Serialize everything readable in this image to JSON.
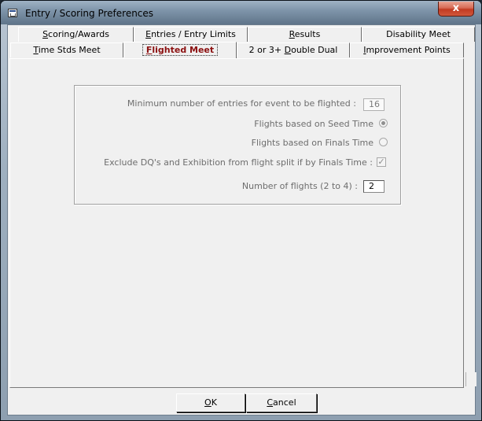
{
  "window": {
    "title": "Entry / Scoring Preferences",
    "close_label": "x"
  },
  "tabs_top": [
    {
      "label": "Scoring/Awards",
      "underline": "S",
      "rest": "coring/Awards"
    },
    {
      "label": "Entries / Entry Limits",
      "underline": "E",
      "rest": "ntries / Entry Limits"
    },
    {
      "label": "Results",
      "underline": "R",
      "rest": "esults"
    },
    {
      "label": "Disability Meet",
      "underline": "",
      "rest": "Disability Meet"
    }
  ],
  "tabs_bottom": [
    {
      "label": "Time Stds Meet",
      "underline": "T",
      "rest": "ime Stds Meet"
    },
    {
      "label": "Flighted Meet",
      "underline": "F",
      "rest": "lighted Meet",
      "active": true
    },
    {
      "label": "2 or 3+ Double Dual",
      "underline": "",
      "pre": "2 or 3+ ",
      "mid": "D",
      "post": "ouble Dual"
    },
    {
      "label": "Improvement Points",
      "underline": "I",
      "rest": "mprovement Points"
    }
  ],
  "flight": {
    "min_entries_label": "Minimum number of entries for event to be flighted :",
    "min_entries_value": "16",
    "seed_time_label": "Flights based on Seed Time",
    "seed_time_selected": true,
    "finals_time_label": "Flights based on Finals Time",
    "finals_time_selected": false,
    "exclude_label": "Exclude DQ's and Exhibition from flight split if by Finals Time :",
    "exclude_checked": true,
    "num_flights_label": "Number of flights (2 to 4) :",
    "num_flights_value": "2"
  },
  "buttons": {
    "ok": {
      "label": "OK",
      "u": "O",
      "rest": "K"
    },
    "cancel": {
      "label": "Cancel",
      "u": "C",
      "rest": "ancel"
    }
  },
  "colors": {
    "active_tab_text": "#8b1010",
    "disabled_text": "#6d6d6d"
  }
}
